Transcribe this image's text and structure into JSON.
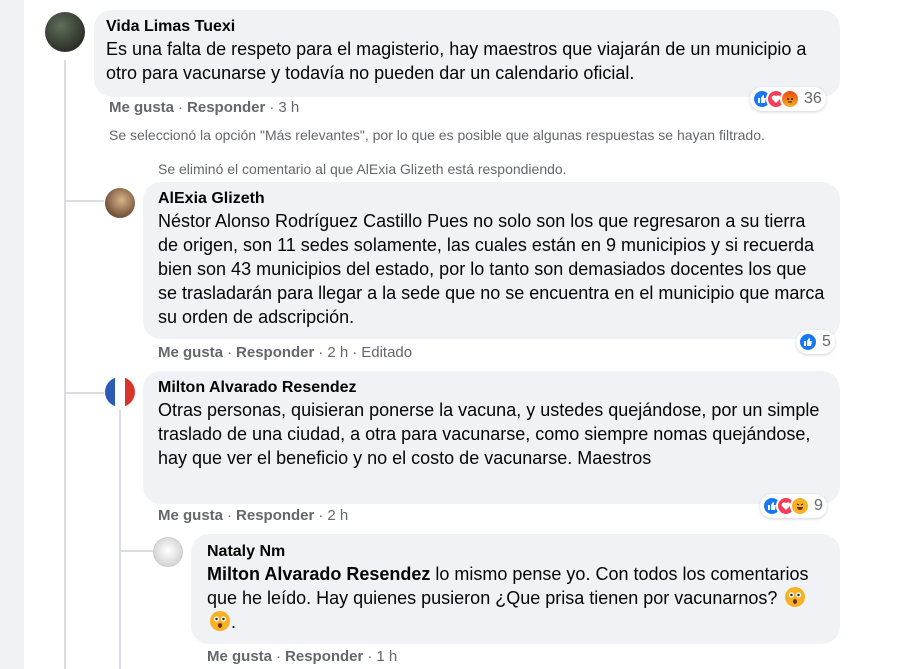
{
  "comments": [
    {
      "author": "Vida Limas Tuexi",
      "text": "Es una falta de respeto para el magisterio, hay maestros que viajarán de un municipio a otro para vacunarse y todavía no pueden dar un calendario oficial.",
      "like_label": "Me gusta",
      "reply_label": "Responder",
      "time": "3 h",
      "reaction_count": "36",
      "reactions": [
        "like-icon",
        "love-icon",
        "angry-icon"
      ]
    }
  ],
  "filter_note": "Se seleccionó la opción \"Más relevantes\", por lo que es posible que algunas respuestas se hayan filtrado.",
  "deleted_note": "Se eliminó el comentario al que AlExia Glizeth está respondiendo.",
  "replies": [
    {
      "author": "AlExia Glizeth",
      "text": "Néstor Alonso Rodríguez Castillo Pues no solo son los que regresaron a su tierra de origen, son 11 sedes solamente, las cuales están en 9 municipios y si recuerda bien son 43 municipios del estado, por lo tanto son demasiados docentes los que se trasladarán para llegar a la sede que no se encuentra en el municipio que marca su orden de adscripción.",
      "like_label": "Me gusta",
      "reply_label": "Responder",
      "time": "2 h",
      "edited_label": "Editado",
      "reaction_count": "5",
      "reactions": [
        "like-icon"
      ]
    },
    {
      "author": "Milton Alvarado Resendez",
      "text": "Otras personas, quisieran ponerse la vacuna, y ustedes quejándose, por un simple traslado de una ciudad, a otra para vacunarse, como siempre nomas quejándose, hay que ver el beneficio y no el costo de vacunarse. Maestros",
      "like_label": "Me gusta",
      "reply_label": "Responder",
      "time": "2 h",
      "reaction_count": "9",
      "reactions": [
        "like-icon",
        "love-icon",
        "haha-icon"
      ]
    },
    {
      "author": "Nataly Nm",
      "mention": "Milton Alvarado Resendez",
      "text": " lo mismo pense yo. Con todos los comentarios que he leído. Hay quienes pusieron ¿Que prisa tienen por vacunarnos? ",
      "emojis": [
        "flushed-face-icon",
        "flushed-face-icon"
      ],
      "text_end": ".",
      "like_label": "Me gusta",
      "reply_label": "Responder",
      "time": "1 h"
    }
  ],
  "colors": {
    "like": "#1877f2",
    "love": "#f33e58",
    "angry": "#e9710f",
    "haha": "#f7b125"
  }
}
